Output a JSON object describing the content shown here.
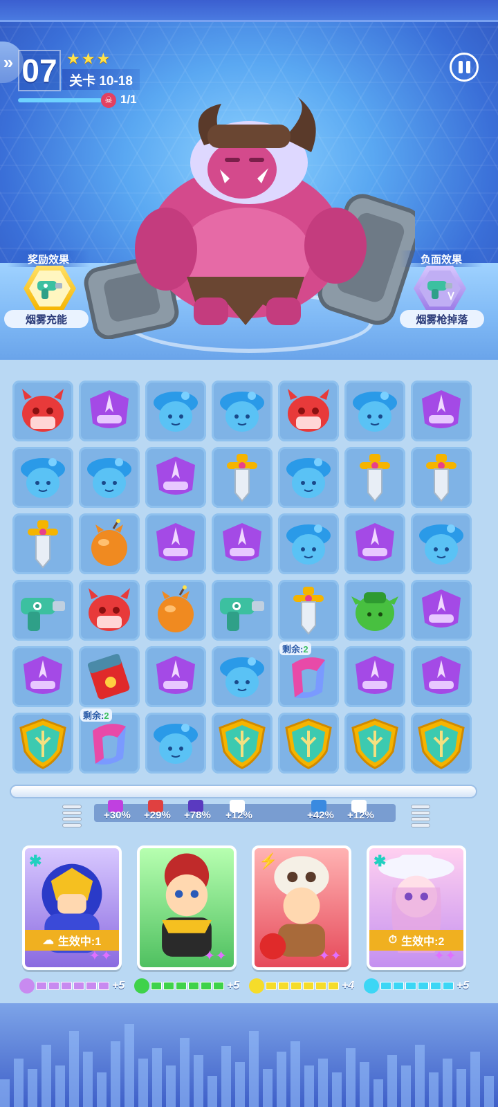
{
  "header": {
    "level_number": "07",
    "stars": "★★★",
    "level_label": "关卡 10-18",
    "wave_progress": 1.0,
    "enemy_count": "1/1",
    "side_button_icon": "double-chevron-right-icon",
    "pause_icon": "pause-icon"
  },
  "effects": {
    "reward_title": "奖励效果",
    "reward_label": "烟雾充能",
    "negative_title": "负面效果",
    "negative_label": "烟雾枪掉落"
  },
  "board": {
    "rows": [
      [
        "devil-red",
        "knight-purple",
        "girl-blue",
        "girl-blue",
        "devil-red",
        "girl-blue",
        "knight-purple"
      ],
      [
        "girl-blue",
        "girl-blue",
        "knight-purple",
        "sword",
        "girl-blue",
        "sword",
        "sword"
      ],
      [
        "sword",
        "bomb",
        "knight-purple",
        "knight-purple",
        "girl-blue",
        "knight-purple",
        "girl-blue"
      ],
      [
        "smoke-gun",
        "devil-red",
        "bomb",
        "smoke-gun",
        "sword",
        "goblin-green",
        "knight-purple"
      ],
      [
        "knight-purple",
        "red-envelope",
        "knight-purple",
        "girl-blue",
        "portal",
        "knight-purple",
        "knight-purple"
      ],
      [
        "shield",
        "portal",
        "girl-blue",
        "shield",
        "shield",
        "shield",
        "shield"
      ]
    ],
    "remain_label": "剩余:",
    "remain_value": "2"
  },
  "bonuses": [
    "+30%",
    "+29%",
    "+78%",
    "+12%",
    "+42%",
    "+12%"
  ],
  "heroes": [
    {
      "name": "purple-knight",
      "status": "生效中:1",
      "status_icon": "cloud-icon",
      "badge": "✱",
      "level_plus": "+5",
      "meter_color": "#c88af0",
      "filled": 6
    },
    {
      "name": "opera-general",
      "status": "",
      "badge": "",
      "level_plus": "+5",
      "meter_color": "#3fd24a",
      "filled": 6
    },
    {
      "name": "caveman",
      "status": "",
      "badge": "⚡",
      "level_plus": "+4",
      "meter_color": "#f5dc2a",
      "filled": 6
    },
    {
      "name": "blue-girl",
      "status": "生效中:2",
      "status_icon": "timer-icon",
      "badge": "✱",
      "level_plus": "+5",
      "meter_color": "#3cd6f5",
      "filled": 6
    }
  ],
  "colors": {
    "accent": "#4a7ae0",
    "cell_bg": "#7fb3e6",
    "status_bar": "#f0b020"
  }
}
